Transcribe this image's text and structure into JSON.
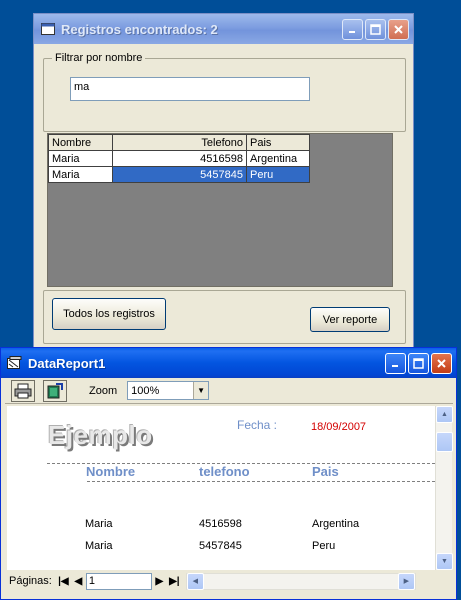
{
  "search_window": {
    "title": "Registros encontrados: 2",
    "filter_group_label": "Filtrar por nombre",
    "filter_value": "ma",
    "grid": {
      "columns": [
        "Nombre",
        "Telefono",
        "Pais"
      ],
      "rows": [
        [
          "Maria",
          "4516598",
          "Argentina"
        ],
        [
          "Maria",
          "5457845",
          "Peru"
        ]
      ]
    },
    "all_records_button": "Todos los registros",
    "view_report_button": "Ver reporte"
  },
  "report_window": {
    "title": "DataReport1",
    "zoom_label": "Zoom",
    "zoom_value": "100%",
    "report": {
      "title": "Ejemplo",
      "date_label": "Fecha :",
      "date_value": "18/09/2007",
      "headers": [
        "Nombre",
        "telefono",
        "Pais"
      ],
      "rows": [
        [
          "Maria",
          "4516598",
          "Argentina"
        ],
        [
          "Maria",
          "5457845",
          "Peru"
        ]
      ]
    },
    "pages_label": "Páginas:",
    "page_value": "1"
  },
  "colors": {
    "desktop": "#004e98",
    "selection": "#316ac5",
    "report_header": "#6f8fc8",
    "report_date": "#d40000"
  }
}
